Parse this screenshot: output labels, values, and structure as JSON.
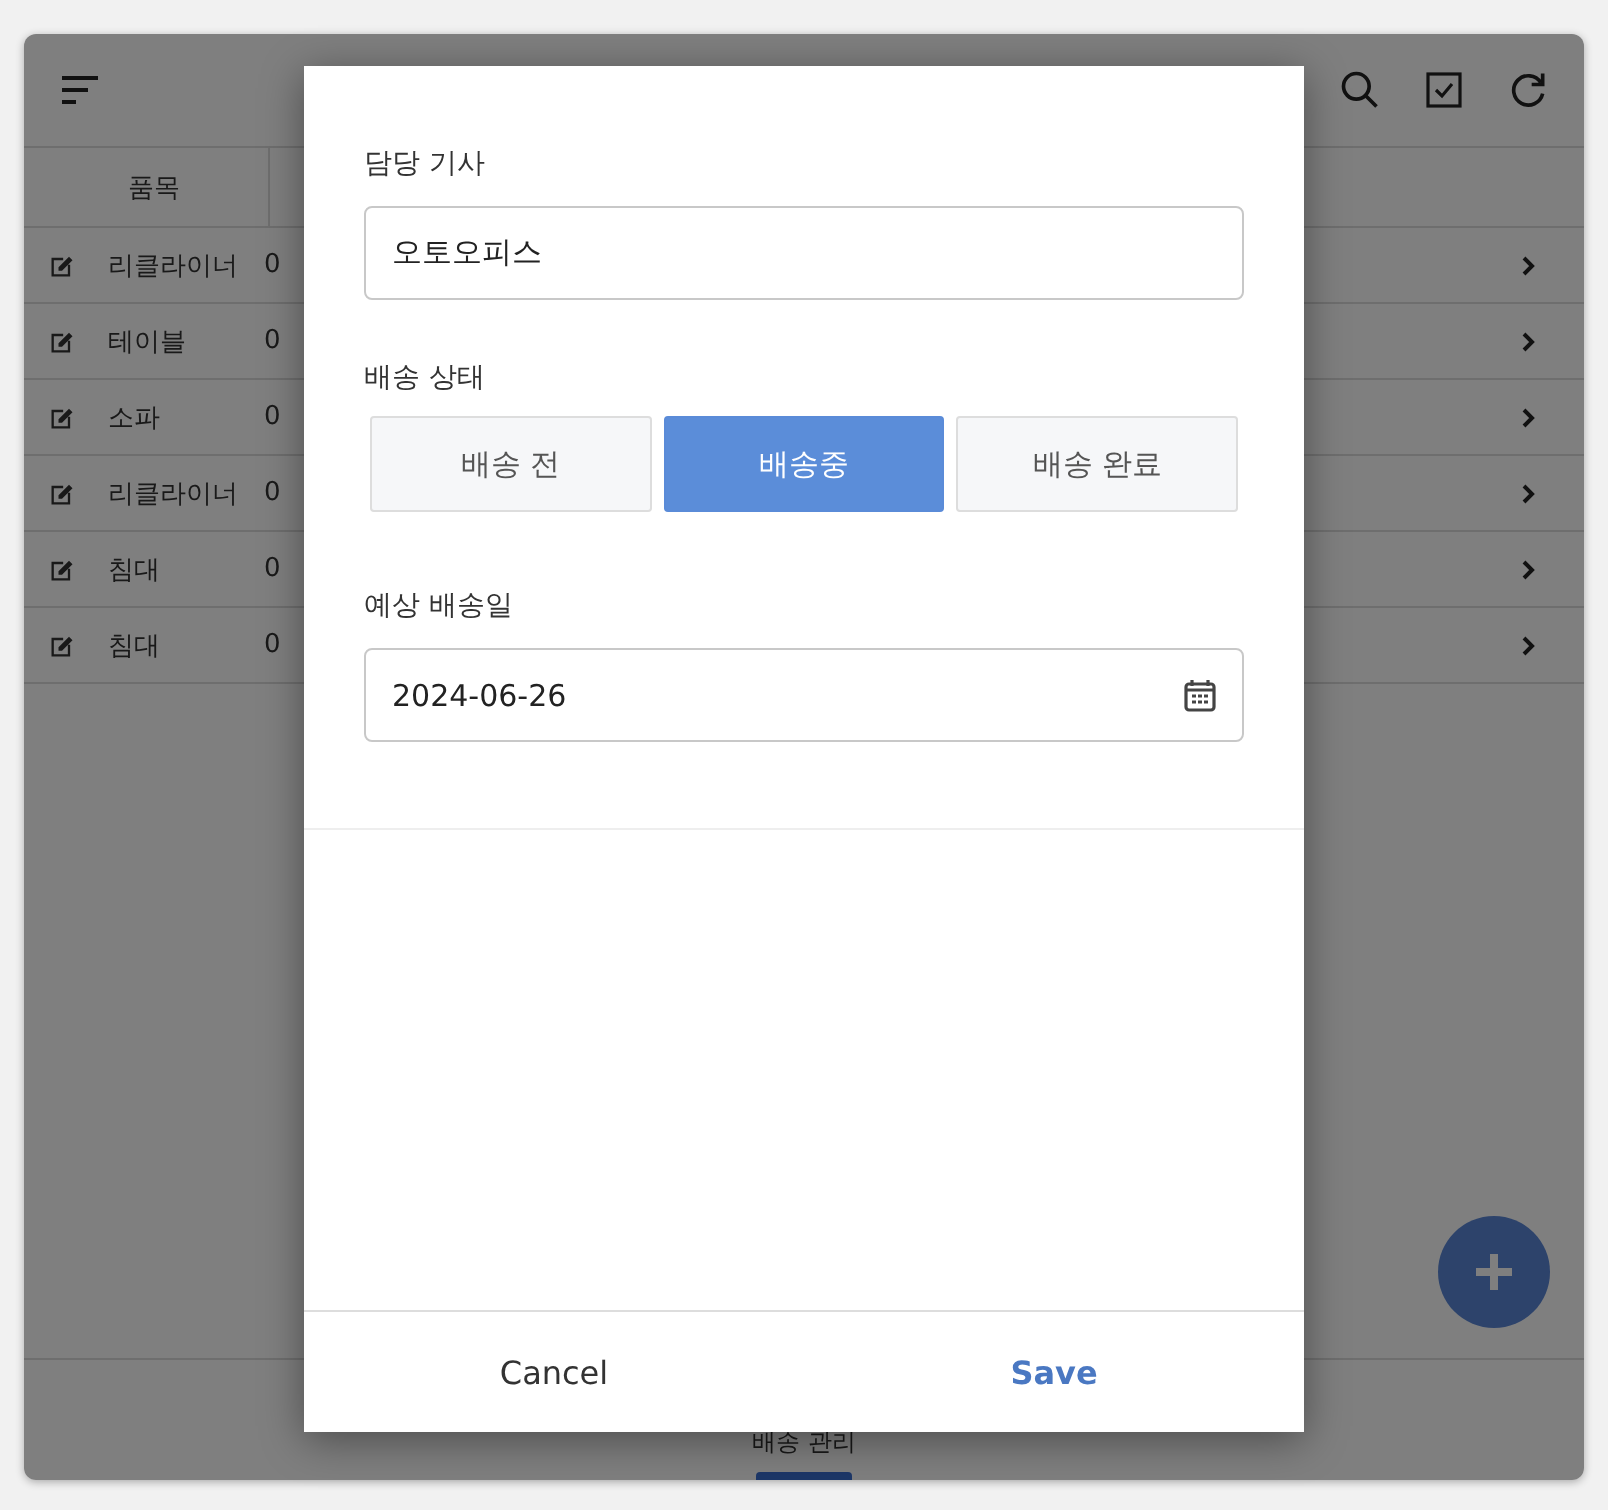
{
  "table": {
    "columns": [
      "품목"
    ],
    "rows": [
      {
        "item": "리클라이너",
        "column_2": "0"
      },
      {
        "item": "테이블",
        "column_2": "0"
      },
      {
        "item": "소파",
        "column_2": "0"
      },
      {
        "item": "리클라이너",
        "column_2": "0"
      },
      {
        "item": "침대",
        "column_2": "0"
      },
      {
        "item": "침대",
        "column_2": "0"
      }
    ]
  },
  "bottom_nav": {
    "label": "배송 관리",
    "selected": true
  },
  "dialog": {
    "driver": {
      "label": "담당 기사",
      "value": "오토오피스"
    },
    "status": {
      "label": "배송 상태",
      "options": [
        {
          "label": "배송 전",
          "selected": false
        },
        {
          "label": "배송중",
          "selected": true
        },
        {
          "label": "배송 완료",
          "selected": false
        }
      ]
    },
    "date": {
      "label": "예상 배송일",
      "value": "2024-06-26"
    },
    "buttons": [
      {
        "label": "Cancel",
        "kind": "secondary"
      },
      {
        "label": "Save",
        "kind": "primary"
      }
    ]
  }
}
